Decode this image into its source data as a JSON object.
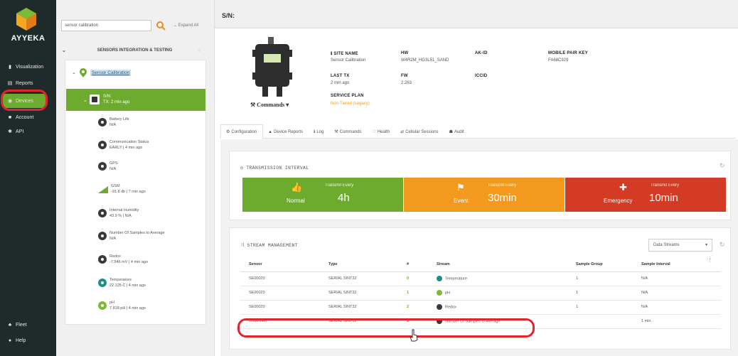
{
  "nav": {
    "brand": "AYYEKA",
    "items": [
      {
        "label": "Visualization",
        "icon": "chart-icon"
      },
      {
        "label": "Reports",
        "icon": "document-icon"
      },
      {
        "label": "Devices",
        "icon": "devices-icon"
      },
      {
        "label": "Account",
        "icon": "account-icon"
      },
      {
        "label": "API",
        "icon": "api-icon"
      }
    ],
    "bottom_items": [
      {
        "label": "Fleet",
        "icon": "fleet-icon"
      },
      {
        "label": "Help",
        "icon": "help-icon"
      }
    ],
    "active": "Devices",
    "accent": "#6cab2d"
  },
  "sidebar": {
    "search_value": "sensor calibration",
    "expand_all": "⌄ Expand All",
    "section_title": "SENSORS INTEGRATION & TESTING",
    "root_label": "Sensor Calibration",
    "device": {
      "sn": "S/N:",
      "tx": "TX: 2 min ago"
    },
    "sensors": [
      {
        "name": "Battery Life",
        "value": "N/A",
        "icon": "dark"
      },
      {
        "name": "Communication Status",
        "value": "EARLY | 4 min ago",
        "icon": "dark"
      },
      {
        "name": "GPS",
        "value": "N/A",
        "icon": "dark"
      },
      {
        "name": "GSM",
        "value": "-91.8 db | 7 min ago",
        "icon": "signal"
      },
      {
        "name": "Internal Humidity",
        "value": "43.9 % | N/A",
        "icon": "dark"
      },
      {
        "name": "Number Of Samples to Average",
        "value": "N/A",
        "icon": "dark"
      },
      {
        "name": "Redox",
        "value": "-7.546 mV | 4 min ago",
        "icon": "dark"
      },
      {
        "name": "Temperature",
        "value": "22.125 C | 4 min ago",
        "icon": "teal"
      },
      {
        "name": "pH",
        "value": "7.818 pH | 4 min ago",
        "icon": "green"
      }
    ]
  },
  "header": {
    "title": "S/N: "
  },
  "device_info": {
    "commands": "Commands",
    "site_name_label": "SITE NAME",
    "site_name": "Sensor Calibration",
    "hw_label": "HW",
    "hw": "W4R2M_HG3L51_SAND",
    "akid_label": "AK-ID",
    "mobile_label": "MOBILE PAIR KEY",
    "mobile": "FA68C929",
    "last_tx_label": "LAST TX",
    "last_tx": "2 min ago",
    "fw_label": "FW",
    "fw": "2.263",
    "iccid_label": "ICCID",
    "plan_label": "SERVICE PLAN",
    "plan": "Non-Tiered (Legacy)"
  },
  "tabs": [
    {
      "label": "Configuration",
      "icon": "wrench-icon"
    },
    {
      "label": "Device Reports",
      "icon": "report-icon"
    },
    {
      "label": "Log",
      "icon": "log-icon"
    },
    {
      "label": "Commands",
      "icon": "command-icon"
    },
    {
      "label": "Health",
      "icon": "health-icon"
    },
    {
      "label": "Cellular Sessions",
      "icon": "cell-icon"
    },
    {
      "label": "Audit",
      "icon": "audit-icon"
    }
  ],
  "transmission": {
    "title": "TRANSMISSION INTERVAL",
    "boxes": [
      {
        "state": "Normal",
        "label": "Transmit Every",
        "value": "4h",
        "color": "#6cab2d",
        "icon": "thumbs-up-icon"
      },
      {
        "state": "Event",
        "label": "Transmit Every",
        "value": "30min",
        "color": "#f39a1e",
        "icon": "flag-icon"
      },
      {
        "state": "Emergency",
        "label": "Transmit Every",
        "value": "10min",
        "color": "#d33b24",
        "icon": "ambulance-icon"
      }
    ]
  },
  "stream": {
    "title": "STREAM MANAGEMENT",
    "dropdown": "Data Streams",
    "columns": [
      "Sensor",
      "Type",
      "#",
      "Stream",
      "Sample Group",
      "Sample Interval"
    ],
    "rows": [
      {
        "sensor": "SE00020",
        "type": "SERIAL SINT32",
        "idx": "0",
        "stream": "Temperature",
        "group": "1",
        "interval": "N/A",
        "color": "#1e8f86"
      },
      {
        "sensor": "SE00020",
        "type": "SERIAL SINT32",
        "idx": "1",
        "stream": "pH",
        "group": "1",
        "interval": "N/A",
        "color": "#7dbb37"
      },
      {
        "sensor": "SE00020",
        "type": "SERIAL SINT32",
        "idx": "2",
        "stream": "Redox",
        "group": "1",
        "interval": "N/A",
        "color": "#3a3a3a"
      },
      {
        "sensor": "Undefined",
        "type": "SERIAL SINT32",
        "idx": "3",
        "stream": "Number Of Samples to Average",
        "group": "",
        "interval": "1 min.",
        "color": "#3a3a3a"
      }
    ]
  }
}
